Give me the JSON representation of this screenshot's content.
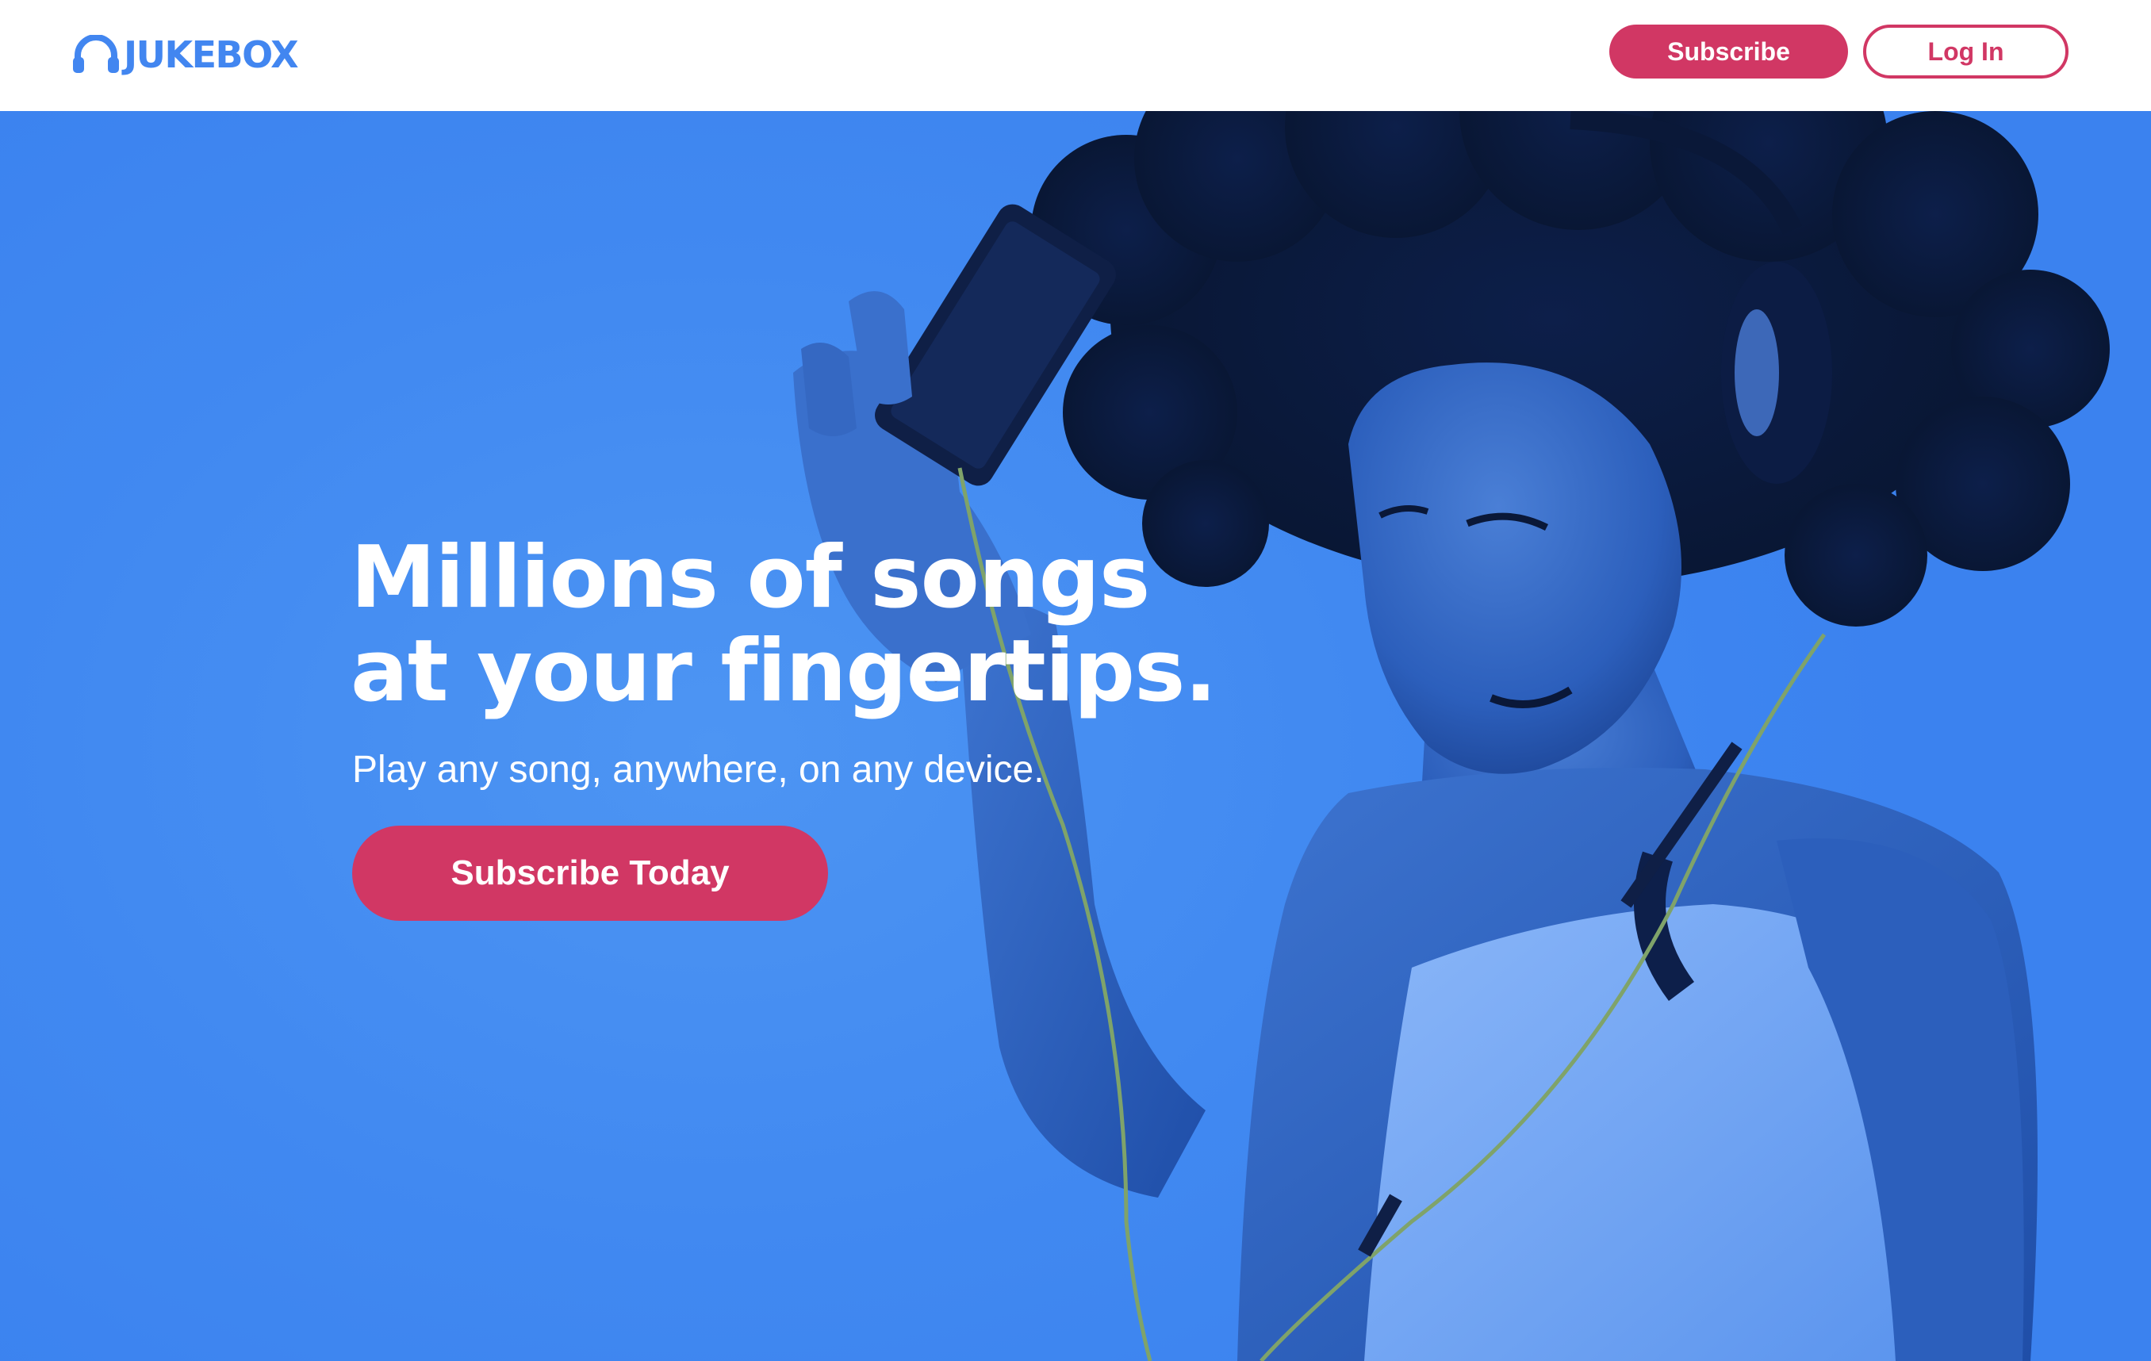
{
  "brand": {
    "name": "JUKEBOX",
    "icon": "headphones-icon",
    "color": "#4286f0"
  },
  "header": {
    "subscribe_label": "Subscribe",
    "login_label": "Log In"
  },
  "hero": {
    "title_line1": "Millions of songs",
    "title_line2": "at your fingertips.",
    "subtitle": "Play any song, anywhere, on any device.",
    "cta_label": "Subscribe Today",
    "image": "woman-with-headphones-photo"
  },
  "colors": {
    "accent": "#d13764",
    "hero_background": "#4189f1",
    "brand_blue": "#4286f0"
  }
}
